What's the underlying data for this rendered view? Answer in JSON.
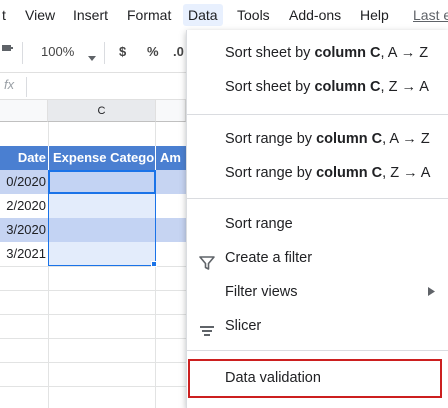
{
  "menubar": {
    "items": [
      "t",
      "View",
      "Insert",
      "Format",
      "Data",
      "Tools",
      "Add-ons",
      "Help"
    ],
    "active": "Data",
    "last_edit": "Last e"
  },
  "toolbar": {
    "zoom": "100%",
    "currency": "$",
    "percent": "%",
    "decimal": ".0"
  },
  "formula_bar": {
    "fx": "fx"
  },
  "sheet": {
    "column_header": "C",
    "header_row": {
      "date": "Date",
      "category": "Expense Catego",
      "amount": "Am"
    },
    "rows": [
      {
        "date": "0/2020"
      },
      {
        "date": "2/2020"
      },
      {
        "date": "3/2020"
      },
      {
        "date": "3/2021"
      }
    ]
  },
  "data_menu": {
    "sort_sheet_az": {
      "prefix": "Sort sheet by ",
      "bold": "column C",
      "suffix": ", A → Z"
    },
    "sort_sheet_za": {
      "prefix": "Sort sheet by ",
      "bold": "column C",
      "suffix": ", Z → A"
    },
    "sort_range_az": {
      "prefix": "Sort range by ",
      "bold": "column C",
      "suffix": ", A → Z"
    },
    "sort_range_za": {
      "prefix": "Sort range by ",
      "bold": "column C",
      "suffix": ", Z → A"
    },
    "sort_range": "Sort range",
    "create_filter": "Create a filter",
    "filter_views": "Filter views",
    "slicer": "Slicer",
    "data_validation": "Data validation"
  },
  "colors": {
    "header_fill": "#4a7fd1",
    "band_fill": "#c6d4f2",
    "selection": "#1a73e8",
    "highlight_box": "#cc1f1f",
    "menu_active": "#e8f0fe"
  },
  "icons": [
    "filter-funnel-icon",
    "slicer-icon",
    "submenu-arrow-icon",
    "dropdown-caret-icon"
  ]
}
